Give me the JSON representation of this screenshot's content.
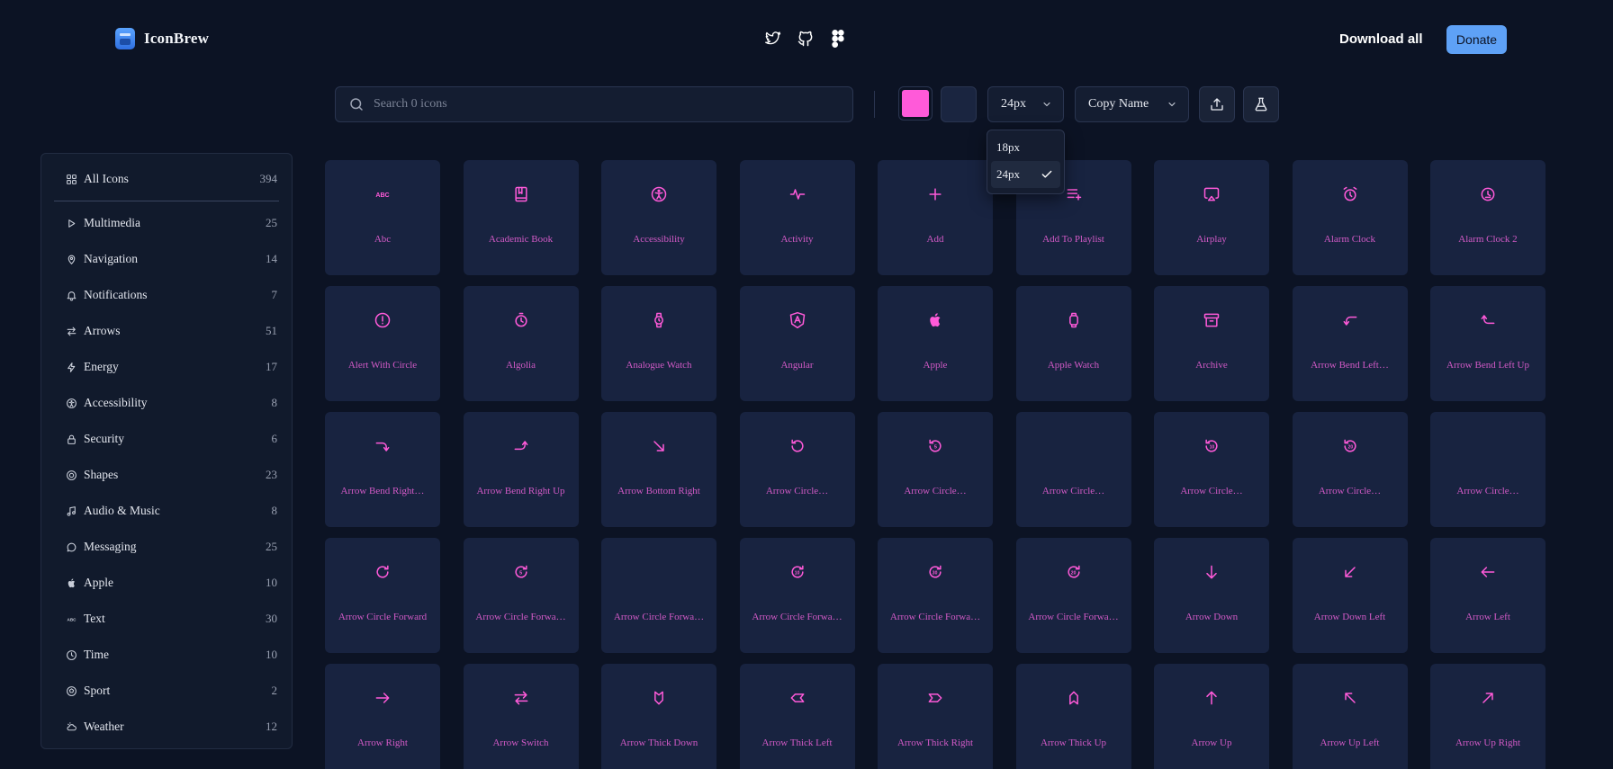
{
  "brand": {
    "name": "IconBrew",
    "logo_icon": "iconbrew-logo-icon"
  },
  "social": [
    "twitter-icon",
    "github-icon",
    "figma-icon"
  ],
  "header": {
    "download_all": "Download all",
    "donate": "Donate"
  },
  "colors": {
    "accent": "#ff5ad9",
    "background": "#0c1324",
    "card": "#182340",
    "donate": "#5ea1f6"
  },
  "toolbar": {
    "search_placeholder": "Search 0 icons",
    "size_value": "24px",
    "copy_value": "Copy Name",
    "icon_color": "#ff5ad9",
    "background_color": "#1a2540"
  },
  "size_dropdown": {
    "options": [
      {
        "label": "18px",
        "selected": false
      },
      {
        "label": "24px",
        "selected": true
      }
    ]
  },
  "sidebar": {
    "all": {
      "label": "All Icons",
      "count": "394"
    },
    "items": [
      {
        "label": "Multimedia",
        "count": "25",
        "icon": "play-icon"
      },
      {
        "label": "Navigation",
        "count": "14",
        "icon": "map-pin-icon"
      },
      {
        "label": "Notifications",
        "count": "7",
        "icon": "bell-icon"
      },
      {
        "label": "Arrows",
        "count": "51",
        "icon": "arrows-switch-icon"
      },
      {
        "label": "Energy",
        "count": "17",
        "icon": "lightning-icon"
      },
      {
        "label": "Accessibility",
        "count": "8",
        "icon": "accessibility-icon"
      },
      {
        "label": "Security",
        "count": "6",
        "icon": "lock-icon"
      },
      {
        "label": "Shapes",
        "count": "23",
        "icon": "shapes-icon"
      },
      {
        "label": "Audio & Music",
        "count": "8",
        "icon": "music-note-icon"
      },
      {
        "label": "Messaging",
        "count": "25",
        "icon": "chat-bubble-icon"
      },
      {
        "label": "Apple",
        "count": "10",
        "icon": "apple-icon"
      },
      {
        "label": "Text",
        "count": "30",
        "icon": "abc-icon"
      },
      {
        "label": "Time",
        "count": "10",
        "icon": "clock-icon"
      },
      {
        "label": "Sport",
        "count": "2",
        "icon": "ball-icon"
      },
      {
        "label": "Weather",
        "count": "12",
        "icon": "weather-icon"
      }
    ]
  },
  "icons": [
    {
      "name": "Abc",
      "icon": "abc-icon"
    },
    {
      "name": "Academic Book",
      "icon": "academic-book-icon"
    },
    {
      "name": "Accessibility",
      "icon": "accessibility-icon"
    },
    {
      "name": "Activity",
      "icon": "activity-icon"
    },
    {
      "name": "Add",
      "icon": "add-icon"
    },
    {
      "name": "Add To Playlist",
      "icon": "add-to-playlist-icon"
    },
    {
      "name": "Airplay",
      "icon": "airplay-icon"
    },
    {
      "name": "Alarm Clock",
      "icon": "alarm-clock-icon"
    },
    {
      "name": "Alarm Clock 2",
      "icon": "alarm-clock-2-icon"
    },
    {
      "name": "Alert With Circle",
      "icon": "alert-circle-icon"
    },
    {
      "name": "Algolia",
      "icon": "algolia-icon"
    },
    {
      "name": "Analogue Watch",
      "icon": "analogue-watch-icon"
    },
    {
      "name": "Angular",
      "icon": "angular-icon"
    },
    {
      "name": "Apple",
      "icon": "apple-icon"
    },
    {
      "name": "Apple Watch",
      "icon": "apple-watch-icon"
    },
    {
      "name": "Archive",
      "icon": "archive-icon"
    },
    {
      "name": "Arrow Bend Left…",
      "icon": "arrow-bend-left-down-icon"
    },
    {
      "name": "Arrow Bend Left Up",
      "icon": "arrow-bend-left-up-icon"
    },
    {
      "name": "Arrow Bend Right…",
      "icon": "arrow-bend-right-down-icon"
    },
    {
      "name": "Arrow Bend Right Up",
      "icon": "arrow-bend-right-up-icon"
    },
    {
      "name": "Arrow Bottom Right",
      "icon": "arrow-bottom-right-icon"
    },
    {
      "name": "Arrow Circle…",
      "icon": "arrow-circle-back-icon"
    },
    {
      "name": "Arrow Circle…",
      "icon": "arrow-circle-back-5-icon"
    },
    {
      "name": "Arrow Circle…",
      "icon": ""
    },
    {
      "name": "Arrow Circle…",
      "icon": "arrow-circle-back-10-icon"
    },
    {
      "name": "Arrow Circle…",
      "icon": "arrow-circle-back-20-icon"
    },
    {
      "name": "Arrow Circle…",
      "icon": ""
    },
    {
      "name": "Arrow Circle Forward",
      "icon": "arrow-circle-forward-icon"
    },
    {
      "name": "Arrow Circle Forwa…",
      "icon": "arrow-circle-forward-5-icon"
    },
    {
      "name": "Arrow Circle Forwa…",
      "icon": ""
    },
    {
      "name": "Arrow Circle Forwa…",
      "icon": "arrow-circle-forward-10-icon"
    },
    {
      "name": "Arrow Circle Forwa…",
      "icon": "arrow-circle-forward-30-icon"
    },
    {
      "name": "Arrow Circle Forwa…",
      "icon": "arrow-circle-forward-20-icon"
    },
    {
      "name": "Arrow Down",
      "icon": "arrow-down-icon"
    },
    {
      "name": "Arrow Down Left",
      "icon": "arrow-down-left-icon"
    },
    {
      "name": "Arrow Left",
      "icon": "arrow-left-icon"
    },
    {
      "name": "Arrow Right",
      "icon": "arrow-right-icon"
    },
    {
      "name": "Arrow Switch",
      "icon": "arrow-switch-icon"
    },
    {
      "name": "Arrow Thick Down",
      "icon": "arrow-thick-down-icon"
    },
    {
      "name": "Arrow Thick Left",
      "icon": "arrow-thick-left-icon"
    },
    {
      "name": "Arrow Thick Right",
      "icon": "arrow-thick-right-icon"
    },
    {
      "name": "Arrow Thick Up",
      "icon": "arrow-thick-up-icon"
    },
    {
      "name": "Arrow Up",
      "icon": "arrow-up-icon"
    },
    {
      "name": "Arrow Up Left",
      "icon": "arrow-up-left-icon"
    },
    {
      "name": "Arrow Up Right",
      "icon": "arrow-up-right-icon"
    }
  ]
}
